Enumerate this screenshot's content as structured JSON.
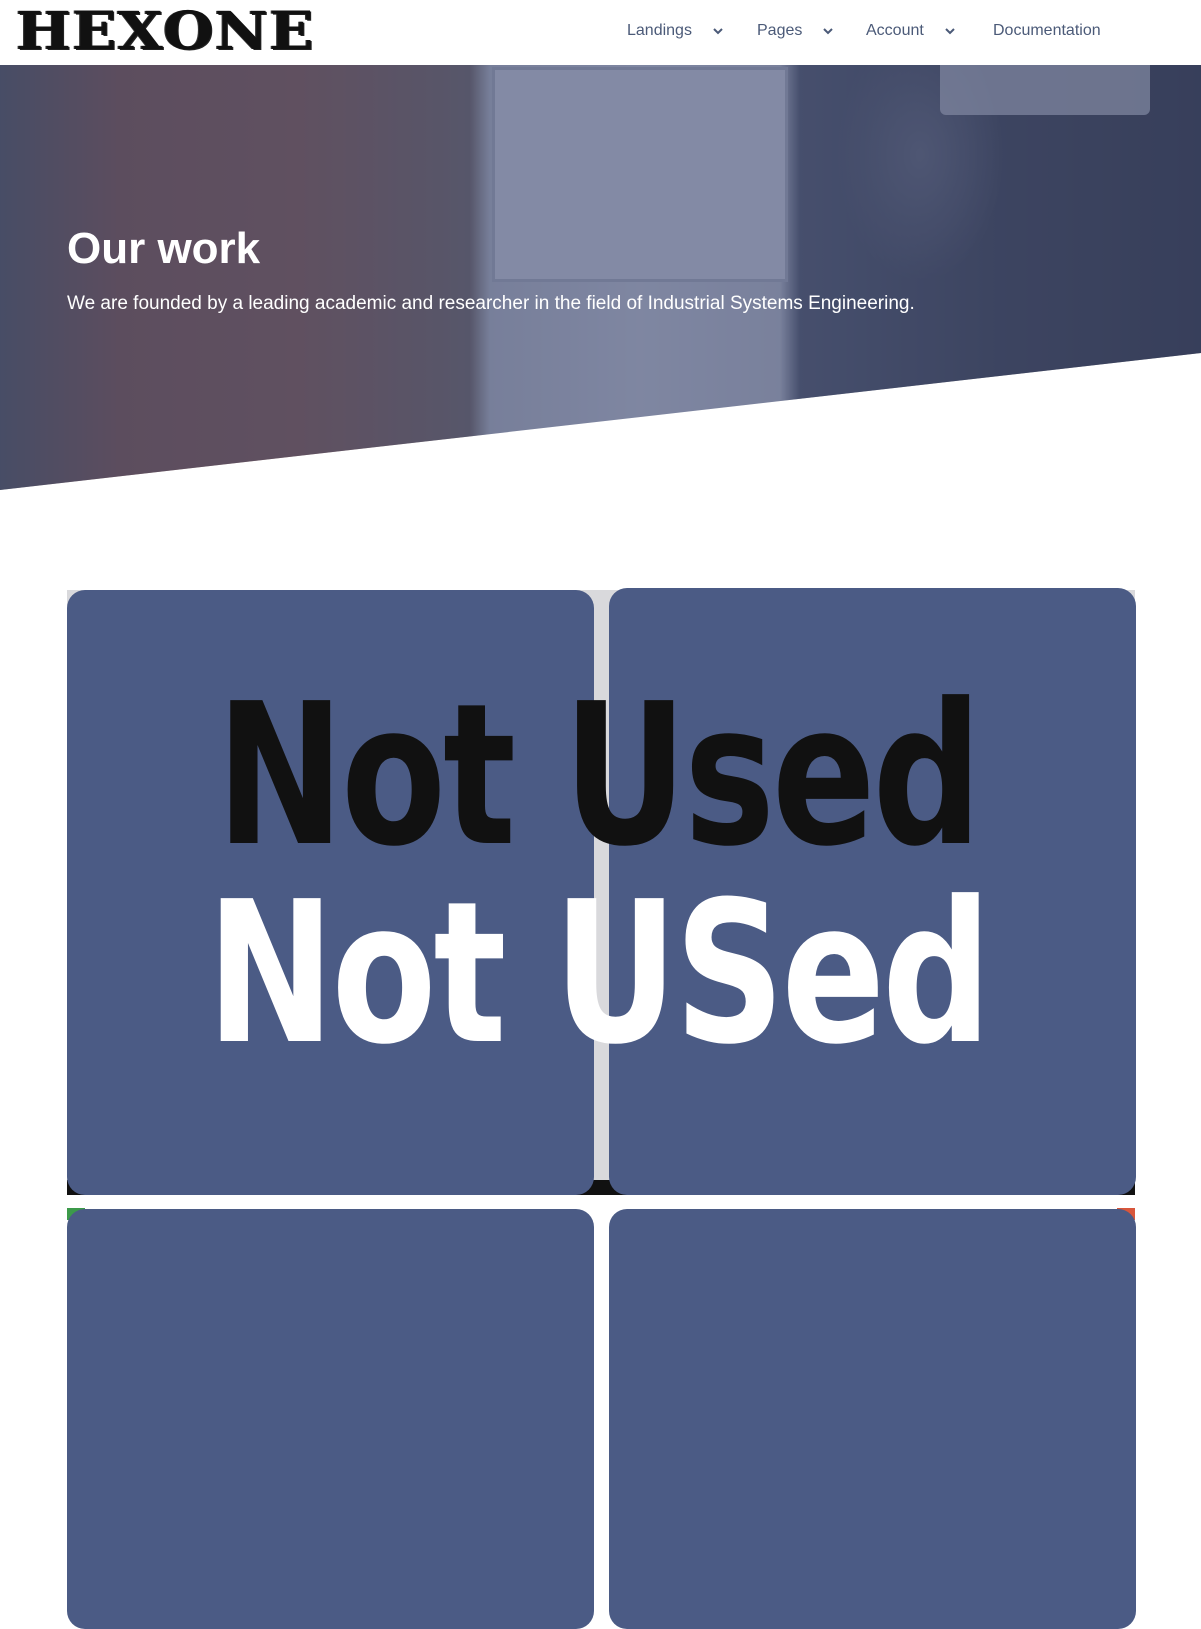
{
  "brand": {
    "logo_text": "HEXONE"
  },
  "nav": {
    "items": [
      {
        "label": "Landings",
        "has_dropdown": true
      },
      {
        "label": "Pages",
        "has_dropdown": true
      },
      {
        "label": "Account",
        "has_dropdown": true
      },
      {
        "label": "Documentation",
        "has_dropdown": false
      }
    ]
  },
  "hero": {
    "title": "Our work",
    "subtitle": "We are founded by a leading academic and researcher in the field of Industrial Systems Engineering."
  },
  "overlay": {
    "line1": "Not Used",
    "line2": "Not USed"
  },
  "colors": {
    "nav_text": "#4b5a78",
    "hero_overlay": "#283462",
    "card_bg": "#4b5b85",
    "accent_green": "#3c9a4a",
    "accent_red": "#d8563b"
  }
}
